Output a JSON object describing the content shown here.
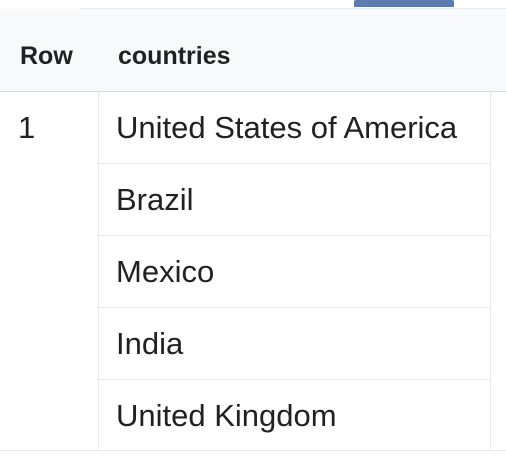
{
  "table": {
    "columns": [
      "Row",
      "countries"
    ],
    "row_number": "1",
    "countries": [
      "United States of America",
      "Brazil",
      "Mexico",
      "India",
      "United Kingdom"
    ]
  },
  "colors": {
    "header_bg": "#f8f9fa",
    "tab_indicator": "#5b7bb1",
    "grid_line": "#e6e8eb",
    "text": "#202124"
  }
}
